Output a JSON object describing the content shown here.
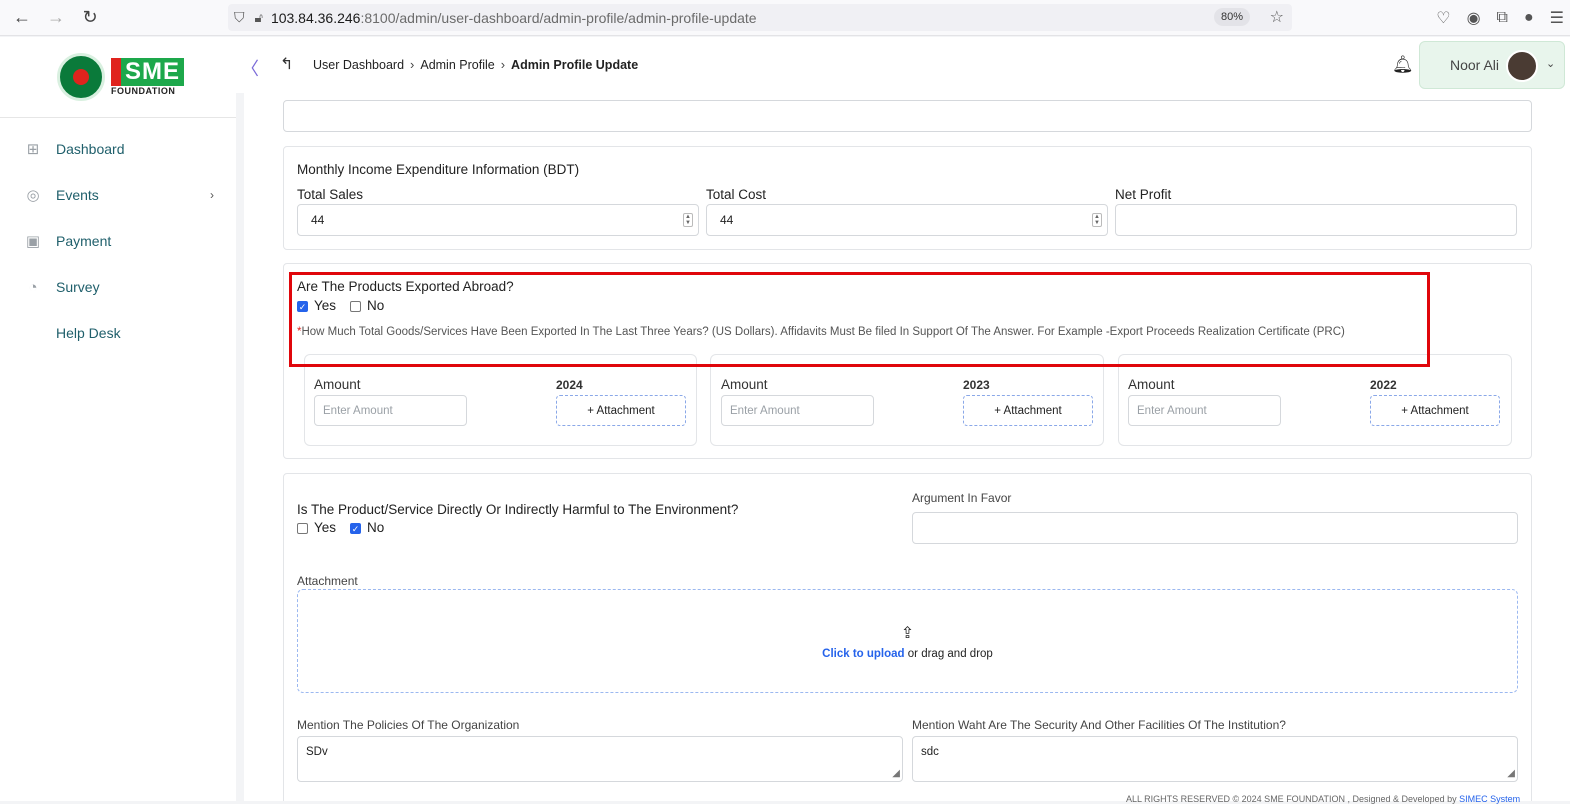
{
  "browser": {
    "url_host": "103.84.36.246",
    "url_path": ":8100/admin/user-dashboard/admin-profile/admin-profile-update",
    "zoom": "80%"
  },
  "sidebar": {
    "logo": {
      "sme": "SME",
      "foundation": "FOUNDATION"
    },
    "items": [
      {
        "label": "Dashboard",
        "icon": "grid-icon"
      },
      {
        "label": "Events",
        "icon": "events-icon"
      },
      {
        "label": "Payment",
        "icon": "payment-icon"
      },
      {
        "label": "Survey",
        "icon": "pie-chart-icon"
      },
      {
        "label": "Help Desk",
        "icon": ""
      }
    ]
  },
  "topbar": {
    "breadcrumbs": [
      "User Dashboard",
      "Admin Profile",
      "Admin Profile Update"
    ],
    "user_name": "Noor Ali"
  },
  "income": {
    "title": "Monthly Income Expenditure Information (BDT)",
    "total_sales_label": "Total Sales",
    "total_sales_value": "44",
    "total_cost_label": "Total Cost",
    "total_cost_value": "44",
    "net_profit_label": "Net Profit",
    "net_profit_value": ""
  },
  "export": {
    "question": "Are The Products Exported Abroad?",
    "yes_label": "Yes",
    "no_label": "No",
    "yes_checked": true,
    "no_checked": false,
    "note_marker": "*",
    "note": "How Much Total Goods/Services Have Been Exported In The Last Three Years? (US Dollars). Affidavits Must Be filed In Support Of The Answer. For Example -Export Proceeds Realization Certificate (PRC)",
    "years": [
      {
        "amount_label": "Amount",
        "year": "2024",
        "placeholder": "Enter Amount",
        "button": "+ Attachment"
      },
      {
        "amount_label": "Amount",
        "year": "2023",
        "placeholder": "Enter Amount",
        "button": "+ Attachment"
      },
      {
        "amount_label": "Amount",
        "year": "2022",
        "placeholder": "Enter Amount",
        "button": "+ Attachment"
      }
    ]
  },
  "environment": {
    "question": "Is The Product/Service Directly Or Indirectly Harmful to The Environment?",
    "yes_label": "Yes",
    "no_label": "No",
    "yes_checked": false,
    "no_checked": true,
    "argument_label": "Argument In Favor",
    "argument_value": "",
    "attachment_label": "Attachment",
    "upload_link": "Click to upload",
    "upload_rest": "or drag and drop"
  },
  "policies": {
    "label": "Mention The Policies Of The Organization",
    "value": "SDv"
  },
  "security": {
    "label": "Mention Waht Are The Security And Other Facilities Of The Institution?",
    "value": "sdc"
  },
  "footer": {
    "text": "ALL RIGHTS RESERVED © 2024 SME FOUNDATION , Designed & Developed by",
    "brand": "SIMEC System"
  }
}
